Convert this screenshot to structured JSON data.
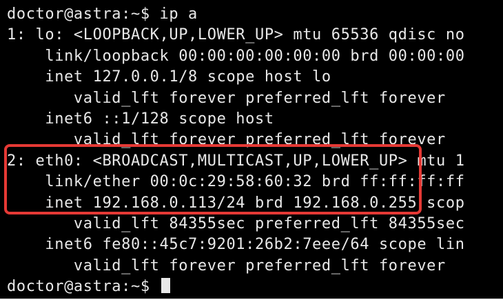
{
  "terminal": {
    "prompt": "doctor@astra:~$ ",
    "lines": [
      "doctor@astra:~$ ip a",
      "1: lo: <LOOPBACK,UP,LOWER_UP> mtu 65536 qdisc no",
      "    link/loopback 00:00:00:00:00:00 brd 00:00:00",
      "    inet 127.0.0.1/8 scope host lo",
      "       valid_lft forever preferred_lft forever",
      "    inet6 ::1/128 scope host",
      "       valid_lft forever preferred_lft forever",
      "2: eth0: <BROADCAST,MULTICAST,UP,LOWER_UP> mtu 1",
      "    link/ether 00:0c:29:58:60:32 brd ff:ff:ff:ff",
      "    inet 192.168.0.113/24 brd 192.168.0.255 scop",
      "       valid_lft 84355sec preferred_lft 84355sec",
      "    inet6 fe80::45c7:9201:26b2:7eee/64 scope lin",
      "       valid_lft forever preferred_lft forever"
    ]
  },
  "colors": {
    "background": "#000000",
    "text": "#e8e8e8",
    "highlight_border": "#e53935"
  },
  "highlight": {
    "covers_lines": [
      7,
      8,
      9
    ]
  }
}
